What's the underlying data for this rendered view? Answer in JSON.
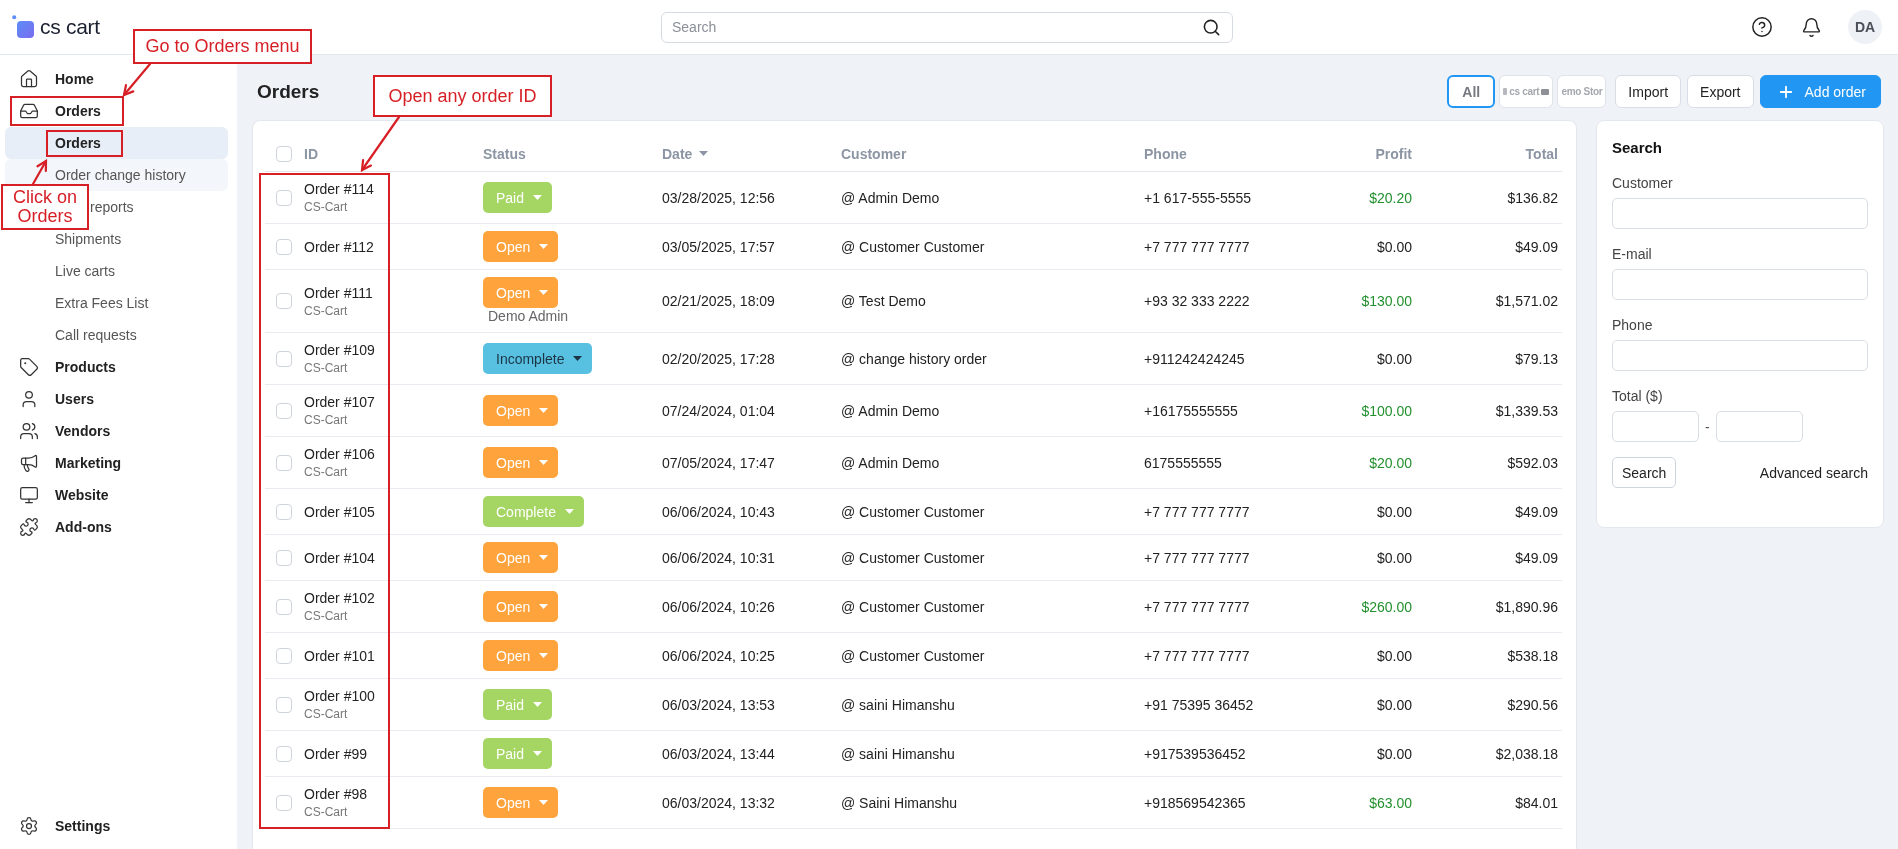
{
  "header": {
    "logo_text": "cs cart",
    "search": {
      "placeholder": "Search"
    },
    "avatar_initials": "DA"
  },
  "sidebar": {
    "items": [
      {
        "label": "Home",
        "annotated": false
      },
      {
        "label": "Orders",
        "annotated": true,
        "children": [
          {
            "label": "Orders",
            "selected": true,
            "hovered": false,
            "annotated": true,
            "partly_hidden": false
          },
          {
            "label": "Order change history",
            "selected": false,
            "hovered": true,
            "annotated": false,
            "partly_hidden": false
          },
          {
            "label": "reports",
            "selected": false,
            "hovered": false,
            "annotated": false,
            "partly_hidden": true
          },
          {
            "label": "Shipments",
            "selected": false,
            "hovered": false,
            "annotated": false,
            "partly_hidden": false
          },
          {
            "label": "Live carts",
            "selected": false,
            "hovered": false,
            "annotated": false,
            "partly_hidden": false
          },
          {
            "label": "Extra Fees List",
            "selected": false,
            "hovered": false,
            "annotated": false,
            "partly_hidden": false
          },
          {
            "label": "Call requests",
            "selected": false,
            "hovered": false,
            "annotated": false,
            "partly_hidden": false
          }
        ]
      },
      {
        "label": "Products",
        "annotated": false
      },
      {
        "label": "Users",
        "annotated": false
      },
      {
        "label": "Vendors",
        "annotated": false
      },
      {
        "label": "Marketing",
        "annotated": false
      },
      {
        "label": "Website",
        "annotated": false
      },
      {
        "label": "Add-ons",
        "annotated": false
      }
    ],
    "footer_item": {
      "label": "Settings"
    }
  },
  "page": {
    "title": "Orders",
    "store_filters": [
      {
        "label": "All",
        "selected": true,
        "kind": "text"
      },
      {
        "label": "cs cart",
        "selected": false,
        "kind": "logo"
      },
      {
        "label": "emo Stor",
        "selected": false,
        "kind": "text"
      }
    ],
    "actions": [
      {
        "label": "Import",
        "kind": "secondary"
      },
      {
        "label": "Export",
        "kind": "secondary"
      },
      {
        "label": "Add order",
        "kind": "primary"
      }
    ]
  },
  "table": {
    "select_all_checked": false,
    "columns": [
      {
        "label": "ID",
        "sorted": false,
        "annotated": true
      },
      {
        "label": "Status",
        "sorted": false,
        "annotated": false
      },
      {
        "label": "Date",
        "sorted": true,
        "annotated": false
      },
      {
        "label": "Customer",
        "sorted": false,
        "annotated": false
      },
      {
        "label": "Phone",
        "sorted": false,
        "annotated": false
      },
      {
        "label": "Profit",
        "sorted": false,
        "annotated": false
      },
      {
        "label": "Total",
        "sorted": false,
        "annotated": false
      }
    ],
    "rows": [
      {
        "checked": false,
        "id": "Order #114",
        "store": "CS-Cart",
        "status": {
          "label": "Paid",
          "kind": "paid"
        },
        "date": "03/28/2025, 12:56",
        "customer": "@ Admin Demo",
        "phone": "+1 617-555-5555",
        "profit": "$20.20",
        "profit_positive": true,
        "total": "$136.82"
      },
      {
        "checked": false,
        "id": "Order #112",
        "status": {
          "label": "Open",
          "kind": "open"
        },
        "date": "03/05/2025, 17:57",
        "customer": "@ Customer Customer",
        "phone": "+7 777 777 7777",
        "profit": "$0.00",
        "profit_positive": false,
        "total": "$49.09"
      },
      {
        "checked": false,
        "id": "Order #111",
        "store": "CS-Cart",
        "status": {
          "label": "Open",
          "kind": "open"
        },
        "status_note": "Demo Admin",
        "date": "02/21/2025, 18:09",
        "customer": "@ Test Demo",
        "phone": "+93 32 333 2222",
        "profit": "$130.00",
        "profit_positive": true,
        "total": "$1,571.02"
      },
      {
        "checked": false,
        "id": "Order #109",
        "store": "CS-Cart",
        "status": {
          "label": "Incomplete",
          "kind": "incomplete"
        },
        "date": "02/20/2025, 17:28",
        "customer": "@ change history order",
        "phone": "+911242424245",
        "profit": "$0.00",
        "profit_positive": false,
        "total": "$79.13"
      },
      {
        "checked": false,
        "id": "Order #107",
        "store": "CS-Cart",
        "status": {
          "label": "Open",
          "kind": "open"
        },
        "date": "07/24/2024, 01:04",
        "customer": "@ Admin Demo",
        "phone": "+16175555555",
        "profit": "$100.00",
        "profit_positive": true,
        "total": "$1,339.53"
      },
      {
        "checked": false,
        "id": "Order #106",
        "store": "CS-Cart",
        "status": {
          "label": "Open",
          "kind": "open"
        },
        "date": "07/05/2024, 17:47",
        "customer": "@ Admin Demo",
        "phone": "6175555555",
        "profit": "$20.00",
        "profit_positive": true,
        "total": "$592.03"
      },
      {
        "checked": false,
        "id": "Order #105",
        "status": {
          "label": "Complete",
          "kind": "complete"
        },
        "date": "06/06/2024, 10:43",
        "customer": "@ Customer Customer",
        "phone": "+7 777 777 7777",
        "profit": "$0.00",
        "profit_positive": false,
        "total": "$49.09"
      },
      {
        "checked": false,
        "id": "Order #104",
        "status": {
          "label": "Open",
          "kind": "open"
        },
        "date": "06/06/2024, 10:31",
        "customer": "@ Customer Customer",
        "phone": "+7 777 777 7777",
        "profit": "$0.00",
        "profit_positive": false,
        "total": "$49.09"
      },
      {
        "checked": false,
        "id": "Order #102",
        "store": "CS-Cart",
        "status": {
          "label": "Open",
          "kind": "open"
        },
        "date": "06/06/2024, 10:26",
        "customer": "@ Customer Customer",
        "phone": "+7 777 777 7777",
        "profit": "$260.00",
        "profit_positive": true,
        "total": "$1,890.96"
      },
      {
        "checked": false,
        "id": "Order #101",
        "status": {
          "label": "Open",
          "kind": "open"
        },
        "date": "06/06/2024, 10:25",
        "customer": "@ Customer Customer",
        "phone": "+7 777 777 7777",
        "profit": "$0.00",
        "profit_positive": false,
        "total": "$538.18"
      },
      {
        "checked": false,
        "id": "Order #100",
        "store": "CS-Cart",
        "status": {
          "label": "Paid",
          "kind": "paid"
        },
        "date": "06/03/2024, 13:53",
        "customer": "@ saini Himanshu",
        "phone": "+91 75395 36452",
        "profit": "$0.00",
        "profit_positive": false,
        "total": "$290.56"
      },
      {
        "checked": false,
        "id": "Order #99",
        "status": {
          "label": "Paid",
          "kind": "paid"
        },
        "date": "06/03/2024, 13:44",
        "customer": "@ saini Himanshu",
        "phone": "+917539536452",
        "profit": "$0.00",
        "profit_positive": false,
        "total": "$2,038.18"
      },
      {
        "checked": false,
        "id": "Order #98",
        "store": "CS-Cart",
        "status": {
          "label": "Open",
          "kind": "open"
        },
        "date": "06/03/2024, 13:32",
        "customer": "@ Saini Himanshu",
        "phone": "+918569542365",
        "profit": "$63.00",
        "profit_positive": true,
        "total": "$84.01"
      }
    ]
  },
  "search_panel": {
    "title": "Search",
    "fields": [
      {
        "label": "Customer",
        "kind": "text"
      },
      {
        "label": "E-mail",
        "kind": "text"
      },
      {
        "label": "Phone",
        "kind": "text"
      },
      {
        "label": "Total ($)",
        "kind": "range",
        "separator": "-"
      }
    ],
    "submit": "Search",
    "advanced_link": "Advanced search"
  },
  "annotations": [
    {
      "text": "Go to Orders menu"
    },
    {
      "text": "Open any order ID"
    },
    {
      "text": "Click on Orders"
    }
  ]
}
